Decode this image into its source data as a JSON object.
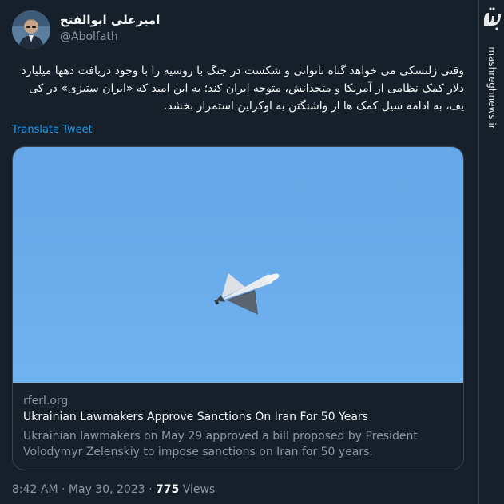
{
  "author": {
    "name": "امیرعلی ابوالفتح",
    "handle": "@Abolfath"
  },
  "tweet": {
    "text": "وقتی زلنسکی می خواهد گناه ناتوانی و شکست در جنگ با روسیه را با وجود دریافت دهها میلیارد دلار کمک نظامی از آمریکا و متحدانش، متوجه ایران کند؛ به این امید که «ایران ستیزی» در کی یف، به ادامه سیل کمک ها از واشنگتن به اوکراین استمرار بخشد.",
    "translate_label": "Translate Tweet"
  },
  "card": {
    "domain": "rferl.org",
    "title": "Ukrainian Lawmakers Approve Sanctions On Iran For 50 Years",
    "description": "Ukrainian lawmakers on May 29 approved a bill proposed by President Volodymyr Zelenskiy to impose sanctions on Iran for 50 years."
  },
  "meta": {
    "time": "8:42 AM",
    "separator": "·",
    "date": "May 30, 2023",
    "views_count": "775",
    "views_label": "Views"
  },
  "watermark": {
    "url": "mashreghnews.ir"
  },
  "colors": {
    "background": "#15202b",
    "accent": "#1d9bf0",
    "secondary_text": "#8b98a5",
    "sky": "#6aabea"
  },
  "icons": [
    "avatar",
    "drone-image",
    "mashregh-logo-icon"
  ]
}
